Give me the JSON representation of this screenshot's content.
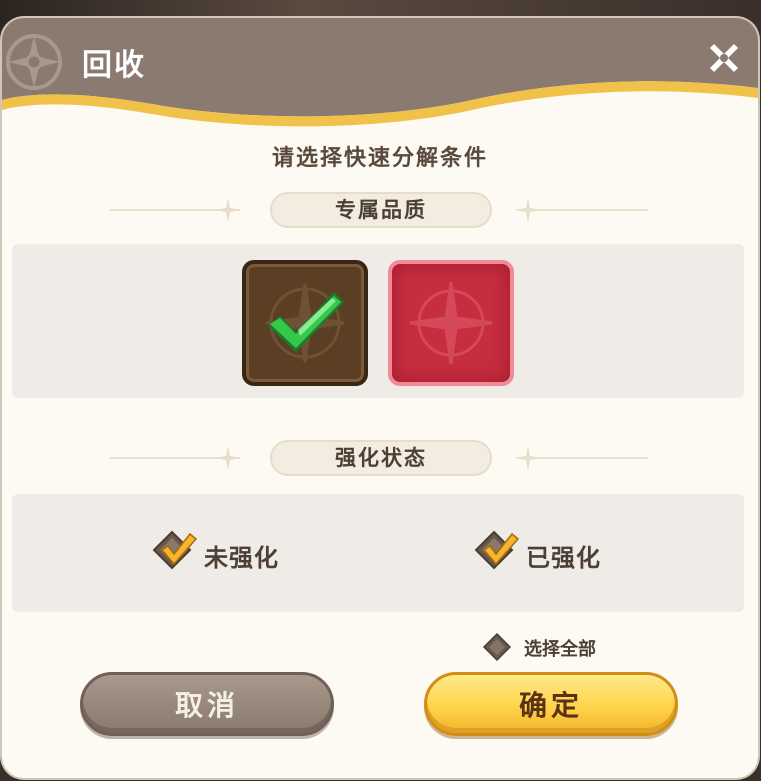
{
  "dialog": {
    "title": "回收",
    "subtitle": "请选择快速分解条件"
  },
  "sections": {
    "quality": {
      "heading": "专属品质",
      "tiles": [
        {
          "name": "brown-quality",
          "selected": true
        },
        {
          "name": "red-quality",
          "selected": false
        }
      ]
    },
    "enhance": {
      "heading": "强化状态",
      "options": [
        {
          "label": "未强化",
          "checked": true
        },
        {
          "label": "已强化",
          "checked": true
        }
      ]
    }
  },
  "select_all": {
    "label": "选择全部",
    "checked": false
  },
  "buttons": {
    "cancel": "取消",
    "confirm": "确定"
  },
  "colors": {
    "header": "#8b7a70",
    "header_gold": "#f0c24a",
    "tile_brown": "#5b3f24",
    "tile_red": "#c62d3f",
    "check_green": "#35c94a",
    "confirm_yellow": "#ffd44a",
    "cancel_gray": "#9a8a7e"
  },
  "icons": {
    "header": "compass-emblem-icon",
    "close": "close-icon",
    "check": "checkmark-icon"
  }
}
